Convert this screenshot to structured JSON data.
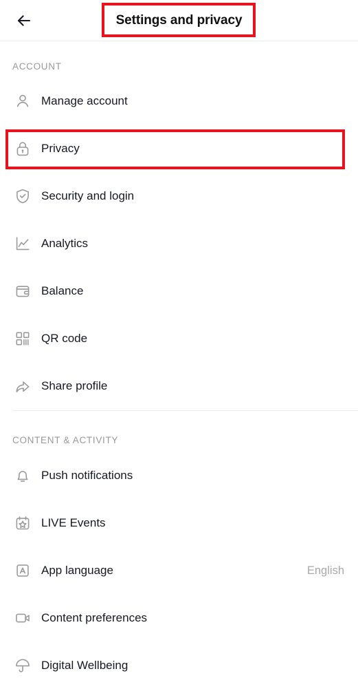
{
  "header": {
    "title": "Settings and privacy",
    "back_icon": "arrow-left-icon"
  },
  "sections": [
    {
      "label": "ACCOUNT",
      "items": [
        {
          "label": "Manage account",
          "icon": "person-icon",
          "value": ""
        },
        {
          "label": "Privacy",
          "icon": "lock-icon",
          "value": ""
        },
        {
          "label": "Security and login",
          "icon": "shield-check-icon",
          "value": ""
        },
        {
          "label": "Analytics",
          "icon": "line-chart-icon",
          "value": ""
        },
        {
          "label": "Balance",
          "icon": "wallet-icon",
          "value": ""
        },
        {
          "label": "QR code",
          "icon": "qr-code-icon",
          "value": ""
        },
        {
          "label": "Share profile",
          "icon": "share-arrow-icon",
          "value": ""
        }
      ]
    },
    {
      "label": "CONTENT & ACTIVITY",
      "items": [
        {
          "label": "Push notifications",
          "icon": "bell-icon",
          "value": ""
        },
        {
          "label": "LIVE Events",
          "icon": "calendar-star-icon",
          "value": ""
        },
        {
          "label": "App language",
          "icon": "letter-a-icon",
          "value": "English"
        },
        {
          "label": "Content preferences",
          "icon": "video-camera-icon",
          "value": ""
        },
        {
          "label": "Digital Wellbeing",
          "icon": "umbrella-icon",
          "value": ""
        }
      ]
    }
  ],
  "highlights": {
    "title_box_color": "#e8131f",
    "privacy_box_color": "#e8131f"
  }
}
